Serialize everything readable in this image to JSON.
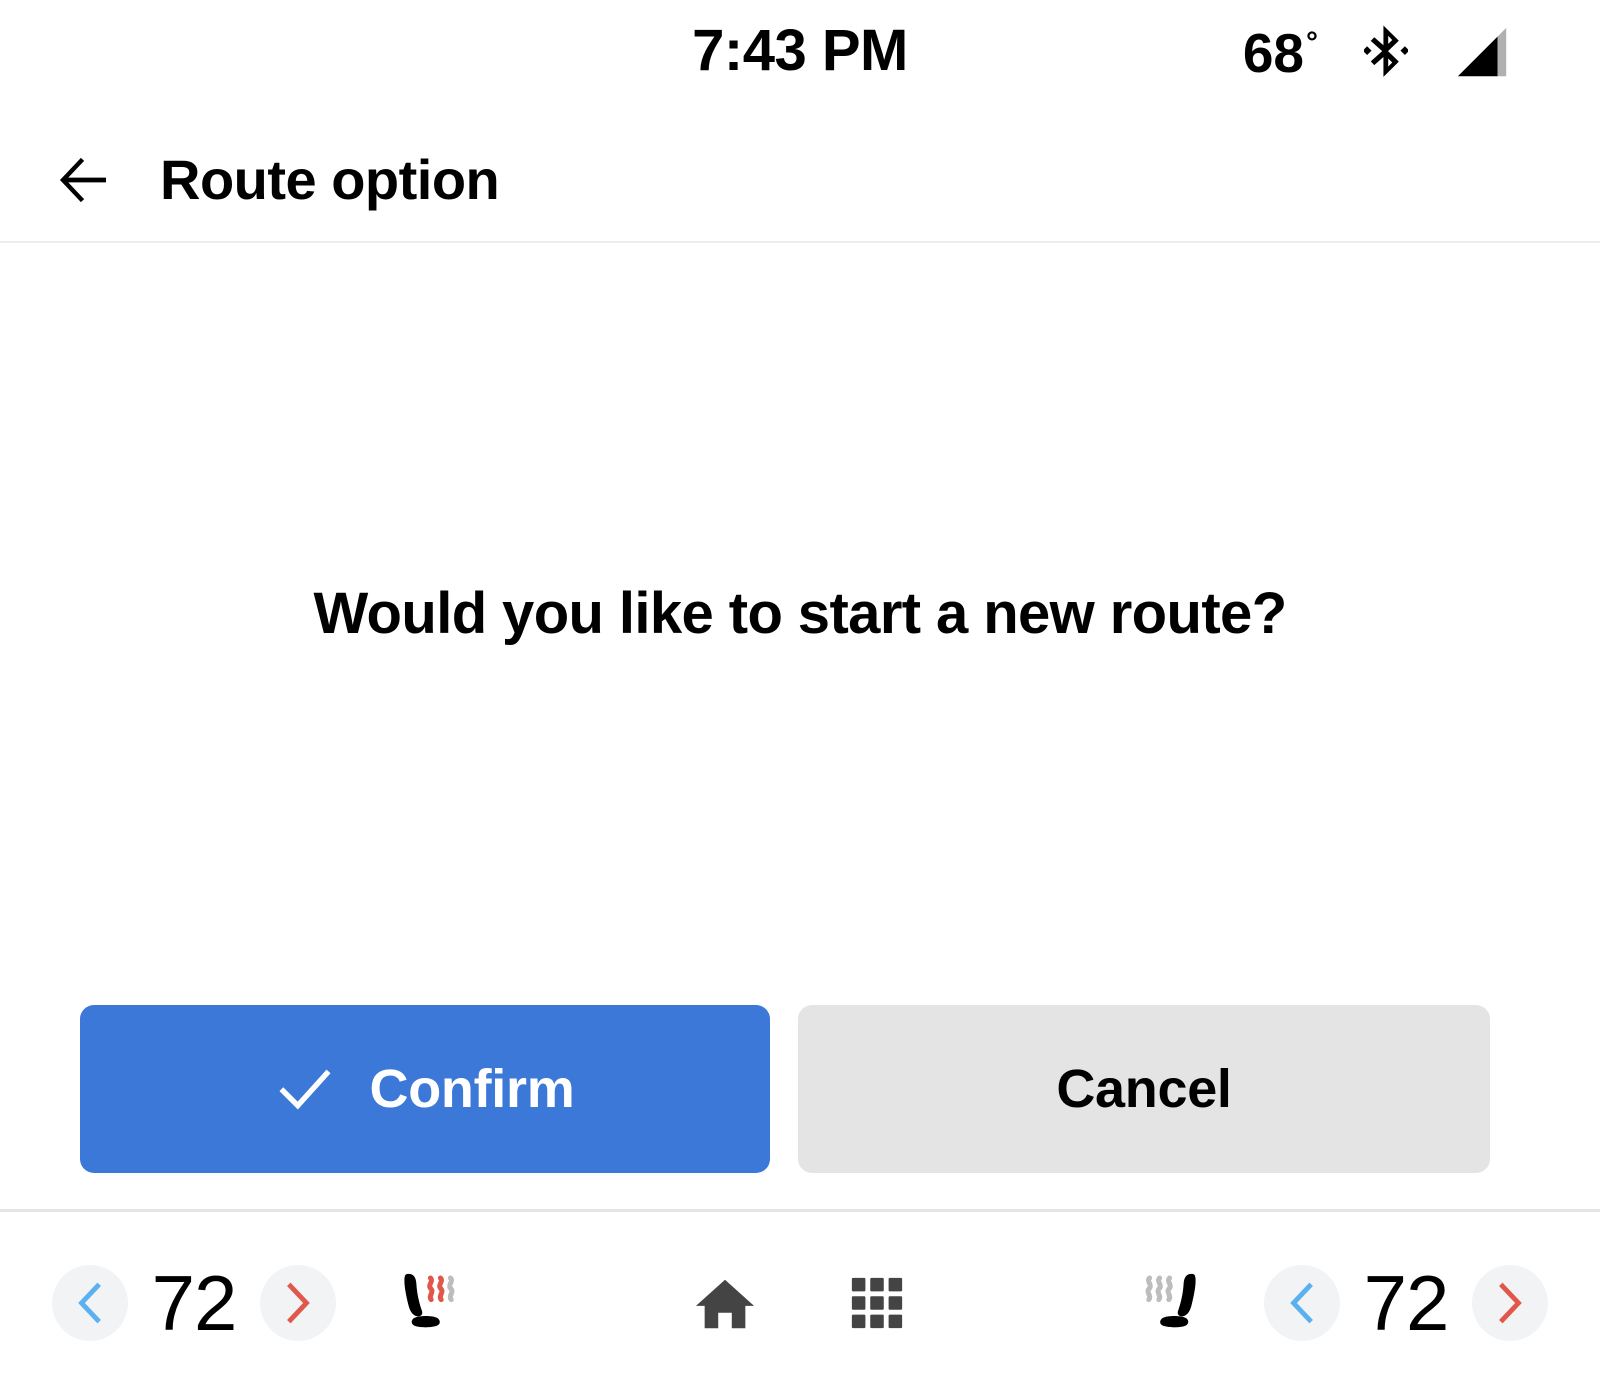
{
  "status_bar": {
    "clock": "7:43 PM",
    "temperature": "68",
    "degree_symbol": "°",
    "bluetooth_icon": "bluetooth-icon",
    "signal_icon": "cellular-signal-icon"
  },
  "header": {
    "back_icon": "back-arrow-icon",
    "title": "Route option"
  },
  "main": {
    "prompt": "Would you like to start a new route?",
    "confirm_label": "Confirm",
    "confirm_icon": "checkmark-icon",
    "cancel_label": "Cancel"
  },
  "climate_bar": {
    "left": {
      "decrease_icon": "chevron-left-icon",
      "temperature": "72",
      "increase_icon": "chevron-right-icon",
      "seat_heater_icon": "heated-seat-icon",
      "seat_heater_level": 2
    },
    "right": {
      "seat_heater_icon": "heated-seat-icon",
      "seat_heater_level": 0,
      "decrease_icon": "chevron-left-icon",
      "temperature": "72",
      "increase_icon": "chevron-right-icon"
    },
    "center": {
      "home_icon": "home-icon",
      "apps_icon": "apps-grid-icon"
    }
  },
  "colors": {
    "confirm_blue": "#3c78d8",
    "cancel_gray": "#e4e4e4",
    "chevron_blue": "#5bb0f0",
    "chevron_red": "#e2574c",
    "heat_active": "#e2574c",
    "heat_inactive": "#bdbdbd",
    "icon_dark": "#444444",
    "round_btn_bg": "#f1f3f4"
  }
}
